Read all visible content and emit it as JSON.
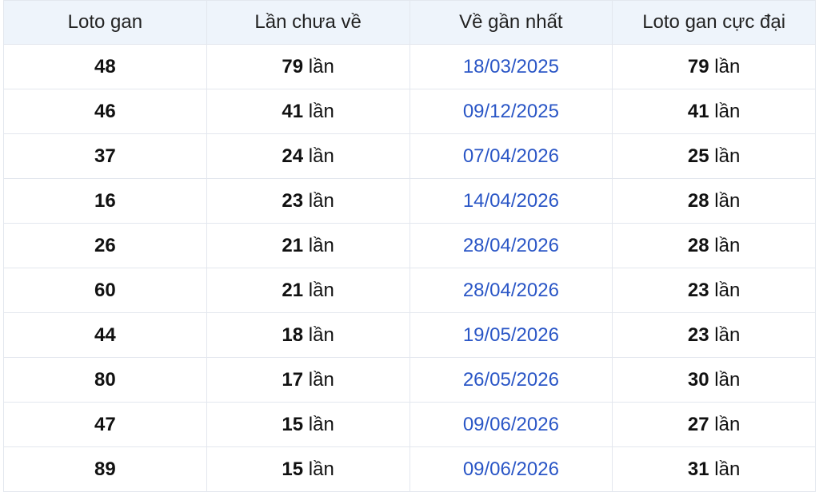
{
  "table": {
    "headers": [
      "Loto gan",
      "Lần chưa về",
      "Về gần nhất",
      "Loto gan cực đại"
    ],
    "unit": "lần",
    "rows": [
      {
        "loto": "48",
        "missed": "79",
        "last": "18/03/2025",
        "max": "79"
      },
      {
        "loto": "46",
        "missed": "41",
        "last": "09/12/2025",
        "max": "41"
      },
      {
        "loto": "37",
        "missed": "24",
        "last": "07/04/2026",
        "max": "25"
      },
      {
        "loto": "16",
        "missed": "23",
        "last": "14/04/2026",
        "max": "28"
      },
      {
        "loto": "26",
        "missed": "21",
        "last": "28/04/2026",
        "max": "28"
      },
      {
        "loto": "60",
        "missed": "21",
        "last": "28/04/2026",
        "max": "23"
      },
      {
        "loto": "44",
        "missed": "18",
        "last": "19/05/2026",
        "max": "23"
      },
      {
        "loto": "80",
        "missed": "17",
        "last": "26/05/2026",
        "max": "30"
      },
      {
        "loto": "47",
        "missed": "15",
        "last": "09/06/2026",
        "max": "27"
      },
      {
        "loto": "89",
        "missed": "15",
        "last": "09/06/2026",
        "max": "31"
      }
    ]
  },
  "colors": {
    "header_bg": "#eef4fb",
    "date_text": "#2a56c6",
    "border": "#e3e7ee"
  }
}
